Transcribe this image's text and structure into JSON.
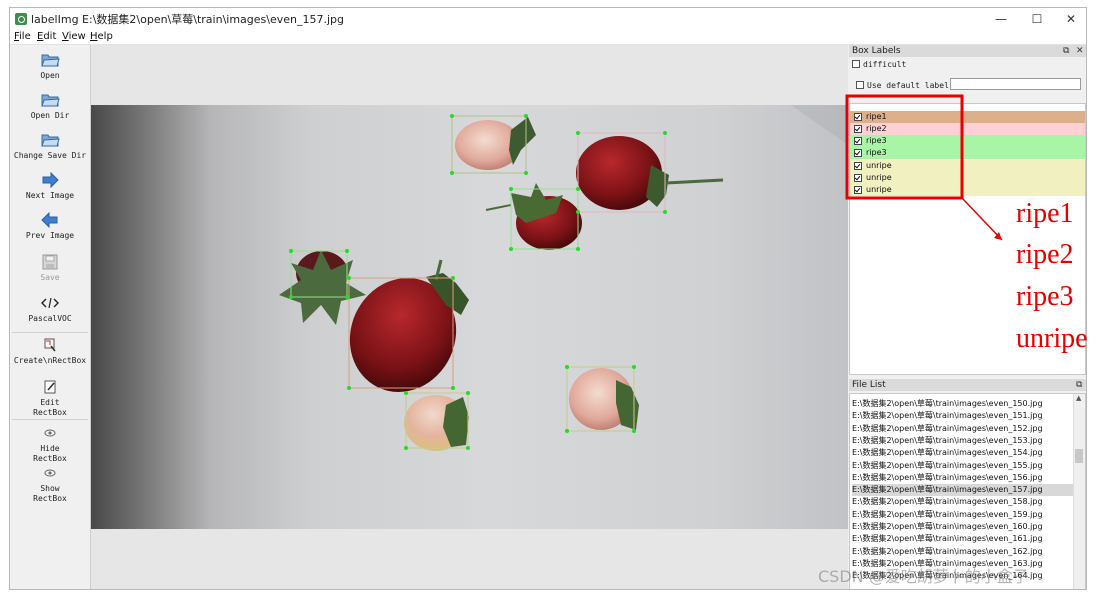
{
  "window": {
    "title": "labelImg E:\\数据集2\\open\\草莓\\train\\images\\even_157.jpg",
    "minimize_glyph": "—",
    "maximize_glyph": "☐",
    "close_glyph": "✕"
  },
  "menu": [
    "File",
    "Edit",
    "View",
    "Help"
  ],
  "toolbar": [
    {
      "icon": "folder-open-icon",
      "label": "Open",
      "enabled": true
    },
    {
      "icon": "folder-open-icon",
      "label": "Open Dir",
      "enabled": true
    },
    {
      "icon": "folder-open-icon",
      "label": "Change Save Dir",
      "enabled": true
    },
    {
      "icon": "arrow-right-icon",
      "label": "Next Image",
      "enabled": true
    },
    {
      "icon": "arrow-left-icon",
      "label": "Prev Image",
      "enabled": true
    },
    {
      "icon": "save-icon",
      "label": "Save",
      "enabled": false
    },
    {
      "icon": "code-icon",
      "label": "PascalVOC",
      "enabled": true
    },
    {
      "icon": "create-rect-icon",
      "label": "Create\\nRectBox",
      "enabled": true
    },
    {
      "icon": "edit-icon",
      "label": "Edit\nRectBox",
      "enabled": true
    },
    {
      "icon": "eye-icon",
      "label": "Hide\nRectBox",
      "enabled": true
    },
    {
      "icon": "eye-icon",
      "label": "Show\nRectBox",
      "enabled": true
    }
  ],
  "box_labels_dock": {
    "title": "Box Labels",
    "difficult_label": "difficult",
    "use_default_label": "Use default label",
    "default_label_value": "",
    "labels": [
      {
        "name": "ripe1",
        "checked": true,
        "color": "#ddb08c"
      },
      {
        "name": "ripe2",
        "checked": true,
        "color": "#ffd0d6"
      },
      {
        "name": "ripe3",
        "checked": true,
        "color": "#a8f5a8"
      },
      {
        "name": "ripe3",
        "checked": true,
        "color": "#a8f5a8"
      },
      {
        "name": "unripe",
        "checked": true,
        "color": "#f0f0c0"
      },
      {
        "name": "unripe",
        "checked": true,
        "color": "#f0f0c0"
      },
      {
        "name": "unripe",
        "checked": true,
        "color": "#f0f0c0"
      }
    ]
  },
  "file_list_dock": {
    "title": "File List",
    "files": [
      "E:\\数据集2\\open\\草莓\\train\\images\\even_150.jpg",
      "E:\\数据集2\\open\\草莓\\train\\images\\even_151.jpg",
      "E:\\数据集2\\open\\草莓\\train\\images\\even_152.jpg",
      "E:\\数据集2\\open\\草莓\\train\\images\\even_153.jpg",
      "E:\\数据集2\\open\\草莓\\train\\images\\even_154.jpg",
      "E:\\数据集2\\open\\草莓\\train\\images\\even_155.jpg",
      "E:\\数据集2\\open\\草莓\\train\\images\\even_156.jpg",
      "E:\\数据集2\\open\\草莓\\train\\images\\even_157.jpg",
      "E:\\数据集2\\open\\草莓\\train\\images\\even_158.jpg",
      "E:\\数据集2\\open\\草莓\\train\\images\\even_159.jpg",
      "E:\\数据集2\\open\\草莓\\train\\images\\even_160.jpg",
      "E:\\数据集2\\open\\草莓\\train\\images\\even_161.jpg",
      "E:\\数据集2\\open\\草莓\\train\\images\\even_162.jpg",
      "E:\\数据集2\\open\\草莓\\train\\images\\even_163.jpg",
      "E:\\数据集2\\open\\草莓\\train\\images\\even_164.jpg"
    ],
    "selected_index": 7
  },
  "annotation": {
    "classes": [
      "ripe1",
      "ripe2",
      "ripe3",
      "unripe"
    ],
    "color": "#e60000"
  },
  "watermark": "CSDN @爱吃胡萝卜的小盒子"
}
